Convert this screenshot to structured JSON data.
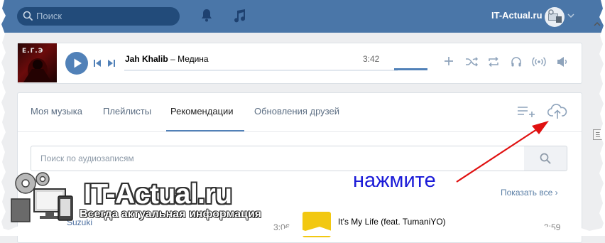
{
  "header": {
    "search_placeholder": "Поиск",
    "brand": "IT-Actual.ru",
    "icons": [
      "search-icon",
      "bell-icon",
      "music-note-icon",
      "chevron-down-icon"
    ],
    "accent": "#4a76a8"
  },
  "player": {
    "artist": "Jah Khalib",
    "separator": "–",
    "title": "Медина",
    "duration": "3:42",
    "cover_text": "E.Г.Э",
    "controls": [
      "play-icon",
      "previous-icon",
      "next-icon",
      "add-icon",
      "shuffle-icon",
      "repeat-icon",
      "headphones-icon",
      "broadcast-icon",
      "speaker-icon"
    ]
  },
  "music": {
    "tabs": [
      {
        "label": "Моя музыка",
        "active": false
      },
      {
        "label": "Плейлисты",
        "active": false
      },
      {
        "label": "Рекомендации",
        "active": true
      },
      {
        "label": "Обновления друзей",
        "active": false
      }
    ],
    "search_placeholder": "Поиск по аудиозаписям",
    "show_all": "Показать все",
    "peek_row": {
      "artist": "Suzuki",
      "time_left": "3:06",
      "title": "It's My Life (feat. TumaniYO)",
      "time_right": "3:59"
    }
  },
  "annotation": {
    "text": "нажмите",
    "color": "#1b1bd8",
    "arrow_color": "#e01010"
  },
  "watermark": {
    "title": "IT-Actual.ru",
    "subtitle": "Всегда актуальная информация"
  }
}
